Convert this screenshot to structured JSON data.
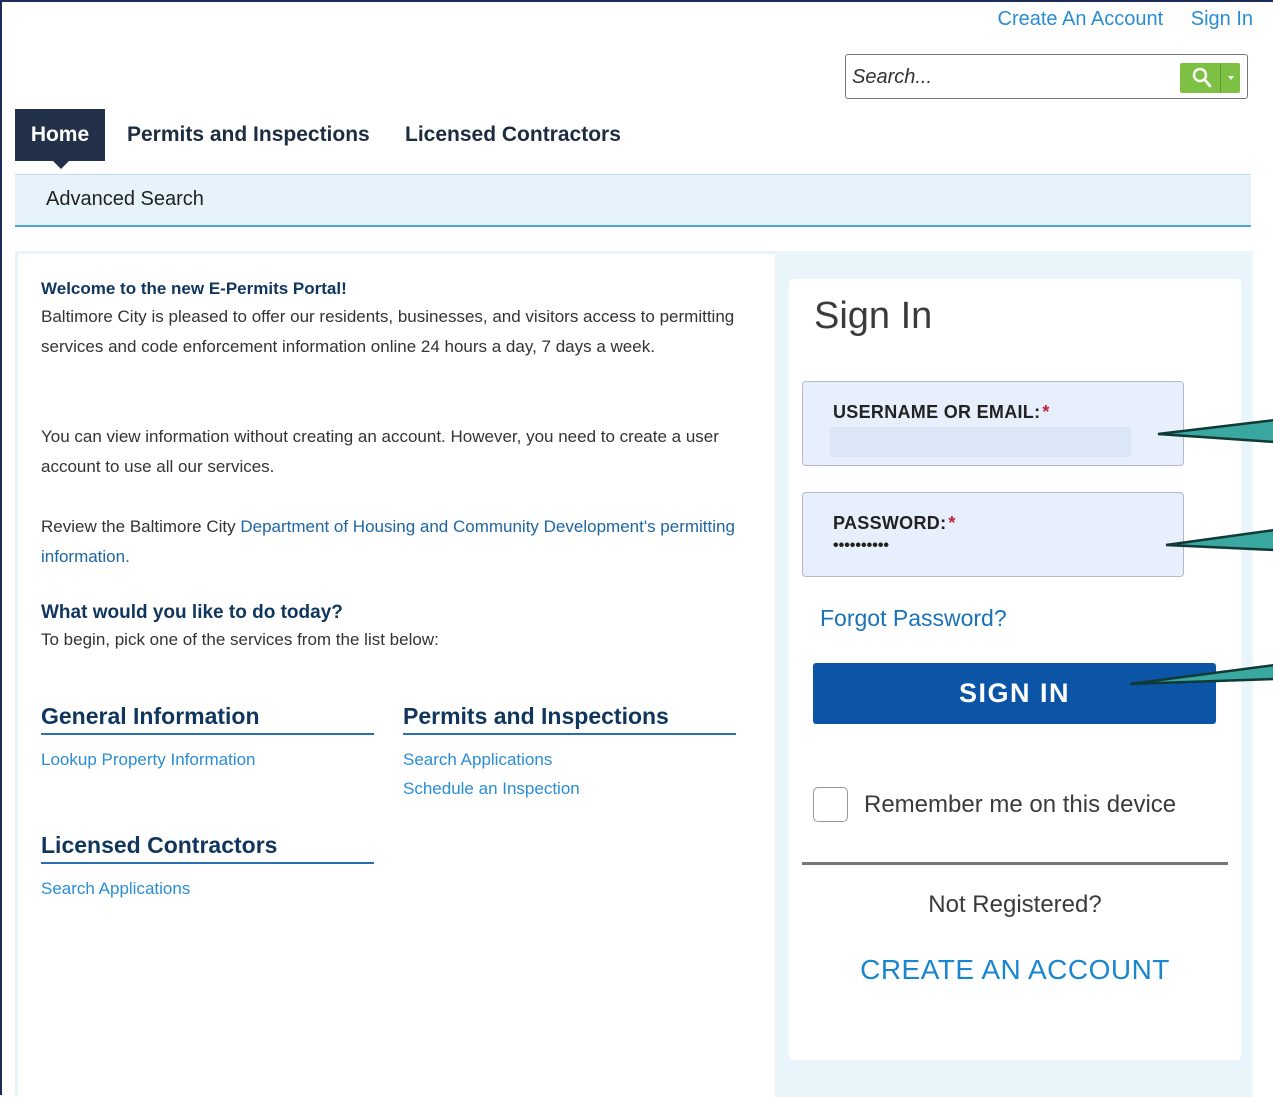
{
  "header": {
    "create_account": "Create An Account",
    "sign_in": "Sign In"
  },
  "search": {
    "placeholder": "Search..."
  },
  "nav": {
    "home": "Home",
    "permits": "Permits and Inspections",
    "contractors": "Licensed Contractors"
  },
  "subnav": {
    "advanced_search": "Advanced Search"
  },
  "intro": {
    "welcome_title": "Welcome to the new E-Permits Portal!",
    "p1": "Baltimore City is pleased to offer our residents, businesses, and visitors access to permitting services and code enforcement information online 24 hours a day, 7 days a week.",
    "p2": "You can view information without creating an account. However, you need to create a user account to use all our services.",
    "p3_prefix": "Review the Baltimore City ",
    "p3_link": "Department of Housing and Community Development's permitting information.",
    "todo_title": "What would you like to do today?",
    "todo_sub": "To begin, pick one of the services from the list below:"
  },
  "services": {
    "general": {
      "title": "General Information",
      "links": [
        "Lookup Property Information"
      ]
    },
    "permits": {
      "title": "Permits and Inspections",
      "links": [
        "Search Applications",
        "Schedule an Inspection"
      ]
    },
    "contractors": {
      "title": "Licensed Contractors",
      "links": [
        "Search Applications"
      ]
    }
  },
  "signin": {
    "title": "Sign In",
    "username_label": "USERNAME OR EMAIL:",
    "username_value": "",
    "password_label": "PASSWORD:",
    "password_value": "••••••••••",
    "required_mark": "*",
    "forgot": "Forgot Password?",
    "button": "SIGN IN",
    "remember": "Remember me on this device",
    "not_registered": "Not Registered?",
    "create_account": "CREATE AN ACCOUNT"
  },
  "colors": {
    "accent": "#0c55a6",
    "link": "#2a8dd4",
    "nav_active": "#23304a",
    "search_button": "#7cc143",
    "callout_fill": "#3aa7a0",
    "callout_stroke": "#0f3a36"
  }
}
